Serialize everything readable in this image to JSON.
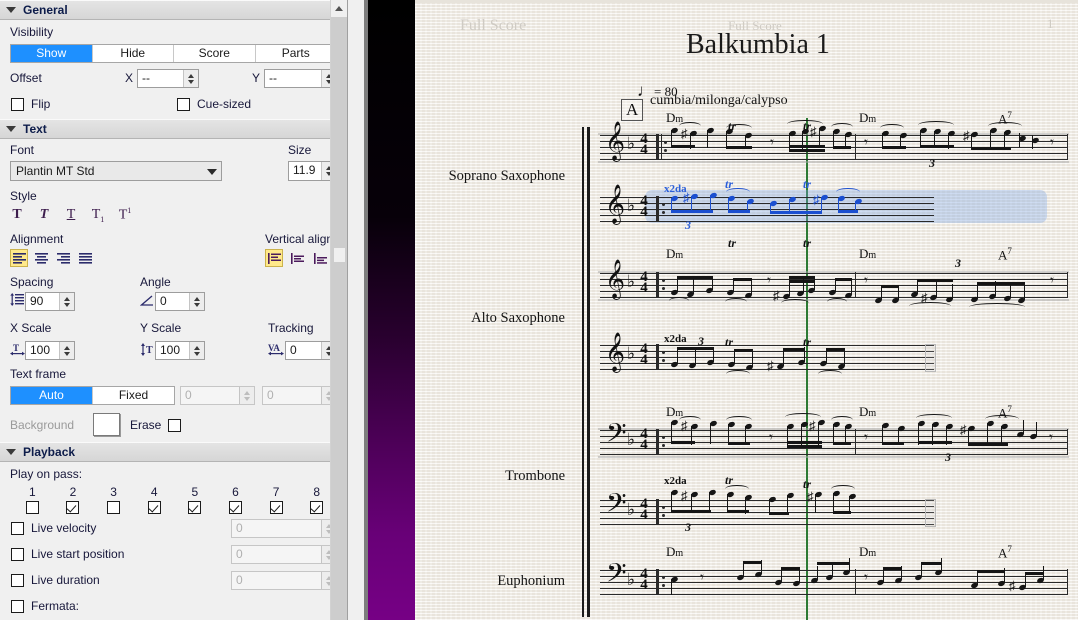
{
  "inspector": {
    "sections": [
      {
        "id": "general",
        "title": "General"
      },
      {
        "id": "text",
        "title": "Text"
      },
      {
        "id": "playback",
        "title": "Playback"
      }
    ],
    "general": {
      "visibility_label": "Visibility",
      "visibility_options": [
        "Show",
        "Hide",
        "Score",
        "Parts"
      ],
      "visibility_selected": "Show",
      "offset_label": "Offset",
      "offset_x_label": "X",
      "offset_x_value": "--",
      "offset_y_label": "Y",
      "offset_y_value": "--",
      "flip_label": "Flip",
      "flip_checked": false,
      "cue_sized_label": "Cue-sized",
      "cue_sized_checked": false
    },
    "text": {
      "font_label": "Font",
      "font_value": "Plantin MT Std",
      "size_label": "Size",
      "size_value": "11.9",
      "style_label": "Style",
      "style_buttons": [
        "bold-T",
        "italic-T",
        "underline-T",
        "subscript-T",
        "superscript-T"
      ],
      "alignment_label": "Alignment",
      "alignment_options": [
        "align-left",
        "align-center",
        "align-right",
        "align-justify"
      ],
      "alignment_selected": "align-left",
      "vertical_align_label": "Vertical align",
      "vertical_align_options": [
        "valign-top",
        "valign-middle",
        "valign-bottom"
      ],
      "vertical_align_selected": "valign-top",
      "spacing_label": "Spacing",
      "spacing_value": "90",
      "angle_label": "Angle",
      "angle_value": "0",
      "x_scale_label": "X Scale",
      "x_scale_value": "100",
      "y_scale_label": "Y Scale",
      "y_scale_value": "100",
      "tracking_label": "Tracking",
      "tracking_value": "0",
      "text_frame_label": "Text frame",
      "text_frame_options": [
        "Auto",
        "Fixed"
      ],
      "text_frame_selected": "Auto",
      "frame_w_value": "0",
      "frame_h_value": "0",
      "background_label": "Background",
      "erase_label": "Erase",
      "erase_checked": false
    },
    "playback": {
      "play_on_pass_label": "Play on pass:",
      "passes": [
        {
          "n": "1",
          "checked": false
        },
        {
          "n": "2",
          "checked": true
        },
        {
          "n": "3",
          "checked": false
        },
        {
          "n": "4",
          "checked": true
        },
        {
          "n": "5",
          "checked": true
        },
        {
          "n": "6",
          "checked": true
        },
        {
          "n": "7",
          "checked": true
        },
        {
          "n": "8",
          "checked": true
        }
      ],
      "live_velocity_label": "Live velocity",
      "live_velocity_checked": false,
      "live_velocity_value": "0",
      "live_start_position_label": "Live start position",
      "live_start_position_checked": false,
      "live_start_position_value": "0",
      "live_duration_label": "Live duration",
      "live_duration_checked": false,
      "live_duration_value": "0",
      "fermata_label": "Fermata:",
      "fermata_checked": false
    }
  },
  "score": {
    "header_left": "Full Score",
    "header_center": "Full Score",
    "title": "Balkumbia 1",
    "page_number": "1",
    "tempo_text": "= 80",
    "tempo_note": "♩",
    "style_text": "cumbia/milonga/calypso",
    "rehearsal_mark": "A",
    "instruments": [
      "Soprano Saxophone",
      "Alto Saxophone",
      "Trombone",
      "Euphonium"
    ],
    "chords_measure_1": "Dm",
    "chords_measure_2": "Dm",
    "chords_measure_2b": "A7",
    "chord_root": "Dm",
    "chord_a7_root": "A",
    "chord_a7_sup": "7",
    "ossia_label": "x2da",
    "trill_label": "tr",
    "tuplet_label": "3",
    "time_sig_top": "4",
    "time_sig_bottom": "4",
    "treble_clef": "𝄞",
    "bass_clef": "𝄢",
    "flat_sign": "♭"
  },
  "colors": {
    "accent_blue": "#1e90ff",
    "selection_blue": "#1b4fd0",
    "highlight_yellow": "#ffe98a",
    "playback_green": "#2d7a34",
    "strip_purple": "#760085",
    "panel_bg": "#f0f0f0",
    "paper": "#f4f1eb"
  }
}
